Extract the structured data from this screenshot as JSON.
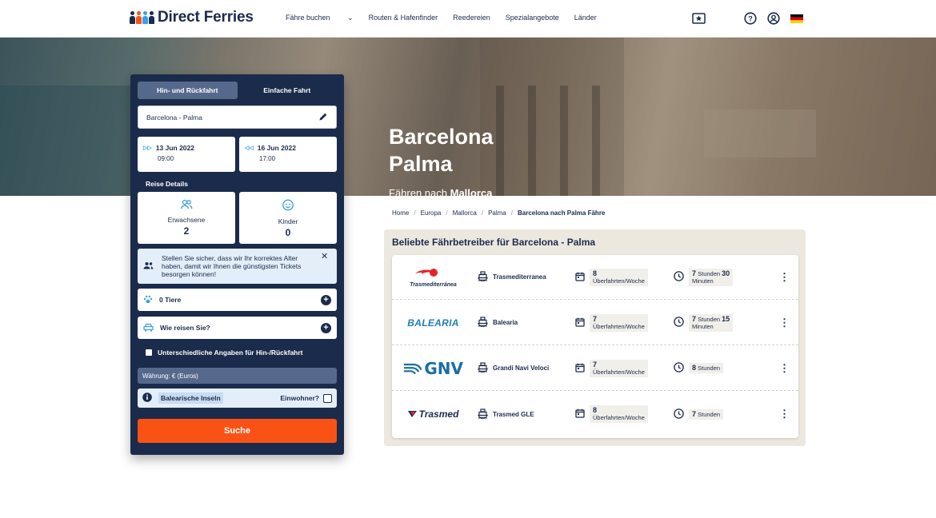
{
  "header": {
    "logo_text": "Direct Ferries",
    "nav": [
      "Fähre buchen",
      "Routen & Hafenfinder",
      "Reedereien",
      "Spezialangebote",
      "Länder"
    ]
  },
  "hero": {
    "line1": "Barcelona",
    "line2": "Palma",
    "subtitle_prefix": "Fähren nach",
    "subtitle_place": "Mallorca"
  },
  "search_panel": {
    "tab_return": "Hin- und Rückfahrt",
    "tab_oneway": "Einfache Fahrt",
    "route": "Barcelona - Palma",
    "outbound_date": "13 Jun 2022",
    "outbound_time": "09:00",
    "return_date": "16 Jun 2022",
    "return_time": "17:00",
    "details_label": "Reise Details",
    "adults_label": "Erwachsene",
    "adults_count": "2",
    "children_label": "Kinder",
    "children_count": "0",
    "notice": "Stellen Sie sicher, dass wir Ihr korrektes Alter haben, damit wir Ihnen die günstigsten Tickets besorgen können!",
    "pets": "0 Tiere",
    "vehicle": "Wie reisen Sie?",
    "different_details": "Unterschiedliche Angaben für Hin-/Rückfahrt",
    "currency": "Währung: € (Euros)",
    "resident_region": "Balearische Inseln",
    "resident_label": "Einwohner?",
    "search_button": "Suche"
  },
  "breadcrumb": [
    "Home",
    "Europa",
    "Mallorca",
    "Palma",
    "Barcelona nach Palma Fähre"
  ],
  "operators_section": {
    "title": "Beliebte Fährbetreiber für Barcelona - Palma",
    "operators": [
      {
        "logo": "Trasmediterránea",
        "name": "Trasmediterranea",
        "crossings": "8",
        "crossings_unit": "Überfahrten/Woche",
        "duration_h": "7",
        "duration_h_unit": "Stunden",
        "duration_m": "30",
        "duration_m_unit": "Minuten"
      },
      {
        "logo": "BALEARIA",
        "name": "Balearia",
        "crossings": "7",
        "crossings_unit": "Überfahrten/Woche",
        "duration_h": "7",
        "duration_h_unit": "Stunden",
        "duration_m": "15",
        "duration_m_unit": "Minuten"
      },
      {
        "logo": "GNV",
        "name": "Grandi Navi Veloci",
        "crossings": "7",
        "crossings_unit": "Überfahrten/Woche",
        "duration_h": "8",
        "duration_h_unit": "Stunden",
        "duration_m": "",
        "duration_m_unit": ""
      },
      {
        "logo": "Trasmed",
        "name": "Trasmed GLE",
        "crossings": "8",
        "crossings_unit": "Überfahrten/Woche",
        "duration_h": "7",
        "duration_h_unit": "Stunden",
        "duration_m": "",
        "duration_m_unit": ""
      }
    ]
  },
  "colors": {
    "navy": "#1b2b4b",
    "search_orange": "#fa5215",
    "light_blue": "#e3eef9",
    "tab_active": "#56698c",
    "section_bg": "#ece8df",
    "balearia": "#1f7fb8",
    "gnv": "#1b6ea8",
    "trasmed_red": "#e0262b"
  },
  "icons": [
    "ticket-star-icon",
    "help-icon",
    "account-icon",
    "german-flag-icon",
    "edit-pencil-icon",
    "calendar-icon",
    "clock-icon",
    "ship-icon",
    "paw-icon",
    "car-icon",
    "plus-icon",
    "info-icon",
    "more-vert-icon"
  ]
}
